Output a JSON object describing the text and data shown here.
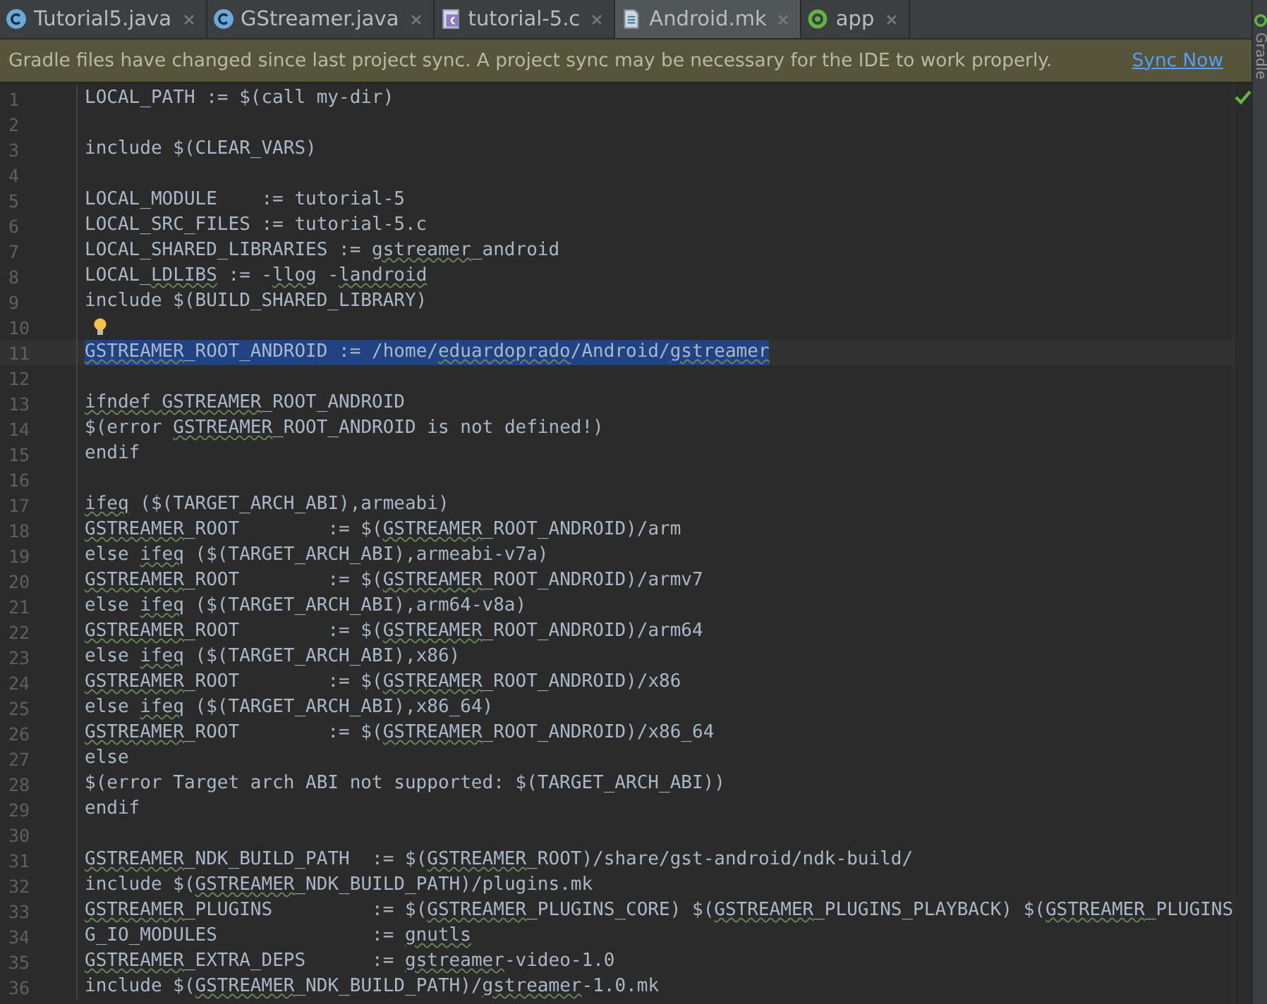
{
  "tabs": [
    {
      "label": "Tutorial5.java",
      "kind": "class",
      "selected": false
    },
    {
      "label": "GStreamer.java",
      "kind": "class",
      "selected": false
    },
    {
      "label": "tutorial-5.c",
      "kind": "c-file",
      "selected": false
    },
    {
      "label": "Android.mk",
      "kind": "text-file",
      "selected": true
    },
    {
      "label": "app",
      "kind": "run-config",
      "selected": false
    }
  ],
  "notification": {
    "message": "Gradle files have changed since last project sync. A project sync may be necessary for the IDE to work properly.",
    "action": "Sync Now"
  },
  "side_tool": {
    "label": "Gradle"
  },
  "editor": {
    "lines": [
      {
        "number": "1",
        "segments": [
          {
            "text": "LOCAL_PATH := $(call my-dir)",
            "typo": false
          }
        ]
      },
      {
        "number": "2"
      },
      {
        "number": "3",
        "segments": [
          {
            "text": "include $(CLEAR_VARS)",
            "typo": false
          }
        ]
      },
      {
        "number": "4"
      },
      {
        "number": "5",
        "segments": [
          {
            "text": "LOCAL_MODULE    := tutorial-5",
            "typo": false
          }
        ]
      },
      {
        "number": "6",
        "segments": [
          {
            "text": "LOCAL_SRC_FILES := tutorial-5.c",
            "typo": false
          }
        ]
      },
      {
        "number": "7",
        "segments": [
          {
            "text": "LOCAL_SHARED_LIBRARIES := ",
            "typo": false
          },
          {
            "text": "gstreamer",
            "typo": true
          },
          {
            "text": "_android",
            "typo": false
          }
        ]
      },
      {
        "number": "8",
        "segments": [
          {
            "text": "LOCAL_",
            "typo": false
          },
          {
            "text": "LDLIBS",
            "typo": true
          },
          {
            "text": " := -",
            "typo": false
          },
          {
            "text": "llog",
            "typo": true
          },
          {
            "text": " -",
            "typo": false
          },
          {
            "text": "landroid",
            "typo": true
          }
        ]
      },
      {
        "number": "9",
        "segments": [
          {
            "text": "include $(BUILD_SHARED_LIBRARY)",
            "typo": false
          }
        ]
      },
      {
        "number": "10",
        "intention_bulb": true
      },
      {
        "number": "11",
        "selected": true,
        "segments": [
          {
            "text": "GSTREAMER",
            "typo": true
          },
          {
            "text": "_ROOT_ANDROID := /home/",
            "typo": false
          },
          {
            "text": "eduardoprado",
            "typo": true
          },
          {
            "text": "/Android/",
            "typo": false
          },
          {
            "text": "gstreamer",
            "typo": true
          }
        ]
      },
      {
        "number": "12"
      },
      {
        "number": "13",
        "segments": [
          {
            "text": "ifndef ",
            "typo": true
          },
          {
            "text": "GSTREAMER",
            "typo": true
          },
          {
            "text": "_ROOT_ANDROID",
            "typo": false
          }
        ]
      },
      {
        "number": "14",
        "segments": [
          {
            "text": "$(error ",
            "typo": false
          },
          {
            "text": "GSTREAMER",
            "typo": true
          },
          {
            "text": "_ROOT_ANDROID is not defined!)",
            "typo": false
          }
        ]
      },
      {
        "number": "15",
        "segments": [
          {
            "text": "endif",
            "typo": false
          }
        ]
      },
      {
        "number": "16"
      },
      {
        "number": "17",
        "segments": [
          {
            "text": "ifeq",
            "typo": true
          },
          {
            "text": " ($(TARGET_ARCH_ABI),armeabi)",
            "typo": false
          }
        ]
      },
      {
        "number": "18",
        "segments": [
          {
            "text": "GSTREAMER",
            "typo": true
          },
          {
            "text": "_ROOT        := $(",
            "typo": false
          },
          {
            "text": "GSTREAMER",
            "typo": true
          },
          {
            "text": "_ROOT_ANDROID)/arm",
            "typo": false
          }
        ]
      },
      {
        "number": "19",
        "segments": [
          {
            "text": "else ",
            "typo": false
          },
          {
            "text": "ifeq",
            "typo": true
          },
          {
            "text": " ($(TARGET_ARCH_ABI),armeabi-v7a)",
            "typo": false
          }
        ]
      },
      {
        "number": "20",
        "segments": [
          {
            "text": "GSTREAMER",
            "typo": true
          },
          {
            "text": "_ROOT        := $(",
            "typo": false
          },
          {
            "text": "GSTREAMER",
            "typo": true
          },
          {
            "text": "_ROOT_ANDROID)/armv7",
            "typo": false
          }
        ]
      },
      {
        "number": "21",
        "segments": [
          {
            "text": "else ",
            "typo": false
          },
          {
            "text": "ifeq",
            "typo": true
          },
          {
            "text": " ($(TARGET_ARCH_ABI),arm64-v8a)",
            "typo": false
          }
        ]
      },
      {
        "number": "22",
        "segments": [
          {
            "text": "GSTREAMER",
            "typo": true
          },
          {
            "text": "_ROOT        := $(",
            "typo": false
          },
          {
            "text": "GSTREAMER",
            "typo": true
          },
          {
            "text": "_ROOT_ANDROID)/arm64",
            "typo": false
          }
        ]
      },
      {
        "number": "23",
        "segments": [
          {
            "text": "else ",
            "typo": false
          },
          {
            "text": "ifeq",
            "typo": true
          },
          {
            "text": " ($(TARGET_ARCH_ABI),x86)",
            "typo": false
          }
        ]
      },
      {
        "number": "24",
        "segments": [
          {
            "text": "GSTREAMER",
            "typo": true
          },
          {
            "text": "_ROOT        := $(",
            "typo": false
          },
          {
            "text": "GSTREAMER",
            "typo": true
          },
          {
            "text": "_ROOT_ANDROID)/x86",
            "typo": false
          }
        ]
      },
      {
        "number": "25",
        "segments": [
          {
            "text": "else ",
            "typo": false
          },
          {
            "text": "ifeq",
            "typo": true
          },
          {
            "text": " ($(TARGET_ARCH_ABI),x86_64)",
            "typo": false
          }
        ]
      },
      {
        "number": "26",
        "segments": [
          {
            "text": "GSTREAMER",
            "typo": true
          },
          {
            "text": "_ROOT        := $(",
            "typo": false
          },
          {
            "text": "GSTREAMER",
            "typo": true
          },
          {
            "text": "_ROOT_ANDROID)/x86_64",
            "typo": false
          }
        ]
      },
      {
        "number": "27",
        "segments": [
          {
            "text": "else",
            "typo": false
          }
        ]
      },
      {
        "number": "28",
        "segments": [
          {
            "text": "$(error Target arch ABI not supported: $(TARGET_ARCH_ABI))",
            "typo": false
          }
        ]
      },
      {
        "number": "29",
        "segments": [
          {
            "text": "endif",
            "typo": false
          }
        ]
      },
      {
        "number": "30"
      },
      {
        "number": "31",
        "segments": [
          {
            "text": "GSTREAMER",
            "typo": true
          },
          {
            "text": "_NDK_BUILD_PATH  := $(",
            "typo": false
          },
          {
            "text": "GSTREAMER",
            "typo": true
          },
          {
            "text": "_ROOT)/share/gst-android/ndk-build/",
            "typo": false
          }
        ]
      },
      {
        "number": "32",
        "segments": [
          {
            "text": "include $(",
            "typo": false
          },
          {
            "text": "GSTREAMER",
            "typo": true
          },
          {
            "text": "_NDK_BUILD_PATH)/plugins.mk",
            "typo": false
          }
        ]
      },
      {
        "number": "33",
        "segments": [
          {
            "text": "GSTREAMER",
            "typo": true
          },
          {
            "text": "_PLUGINS         := $(",
            "typo": false
          },
          {
            "text": "GSTREAMER",
            "typo": true
          },
          {
            "text": "_PLUGINS_CORE) $(",
            "typo": false
          },
          {
            "text": "GSTREAMER",
            "typo": true
          },
          {
            "text": "_PLUGINS_PLAYBACK) $(",
            "typo": false
          },
          {
            "text": "GSTREAMER",
            "typo": true
          },
          {
            "text": "_PLUGINS",
            "typo": false
          }
        ]
      },
      {
        "number": "34",
        "segments": [
          {
            "text": "G_IO_MODULES              := ",
            "typo": false
          },
          {
            "text": "gnutls",
            "typo": true
          }
        ]
      },
      {
        "number": "35",
        "segments": [
          {
            "text": "GSTREAMER",
            "typo": true
          },
          {
            "text": "_EXTRA_DEPS      := ",
            "typo": false
          },
          {
            "text": "gstreamer",
            "typo": true
          },
          {
            "text": "-video-1.0",
            "typo": false
          }
        ]
      },
      {
        "number": "36",
        "segments": [
          {
            "text": "include $(",
            "typo": false
          },
          {
            "text": "GSTREAMER",
            "typo": true
          },
          {
            "text": "_NDK_BUILD_PATH)/",
            "typo": false
          },
          {
            "text": "gstreamer",
            "typo": true
          },
          {
            "text": "-1.0.mk",
            "typo": false
          }
        ]
      }
    ]
  }
}
